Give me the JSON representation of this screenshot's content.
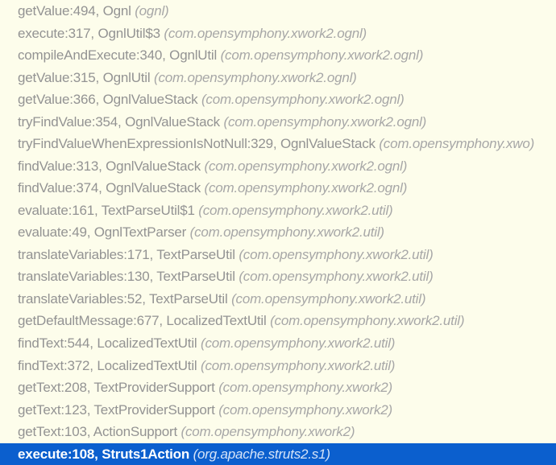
{
  "colors": {
    "background": "#fdfdeb",
    "text": "#939393",
    "pkgText": "#a7a7a7",
    "selectedBg": "#0b5fce",
    "selectedText": "#ffffff",
    "selectedPkg": "#d6e4f8"
  },
  "stackFrames": [
    {
      "method": "getValue",
      "line": 494,
      "class": "Ognl",
      "package": "ognl",
      "selected": false
    },
    {
      "method": "execute",
      "line": 317,
      "class": "OgnlUtil$3",
      "package": "com.opensymphony.xwork2.ognl",
      "selected": false
    },
    {
      "method": "compileAndExecute",
      "line": 340,
      "class": "OgnlUtil",
      "package": "com.opensymphony.xwork2.ognl",
      "selected": false
    },
    {
      "method": "getValue",
      "line": 315,
      "class": "OgnlUtil",
      "package": "com.opensymphony.xwork2.ognl",
      "selected": false
    },
    {
      "method": "getValue",
      "line": 366,
      "class": "OgnlValueStack",
      "package": "com.opensymphony.xwork2.ognl",
      "selected": false
    },
    {
      "method": "tryFindValue",
      "line": 354,
      "class": "OgnlValueStack",
      "package": "com.opensymphony.xwork2.ognl",
      "selected": false
    },
    {
      "method": "tryFindValueWhenExpressionIsNotNull",
      "line": 329,
      "class": "OgnlValueStack",
      "package": "com.opensymphony.xwo",
      "selected": false
    },
    {
      "method": "findValue",
      "line": 313,
      "class": "OgnlValueStack",
      "package": "com.opensymphony.xwork2.ognl",
      "selected": false
    },
    {
      "method": "findValue",
      "line": 374,
      "class": "OgnlValueStack",
      "package": "com.opensymphony.xwork2.ognl",
      "selected": false
    },
    {
      "method": "evaluate",
      "line": 161,
      "class": "TextParseUtil$1",
      "package": "com.opensymphony.xwork2.util",
      "selected": false
    },
    {
      "method": "evaluate",
      "line": 49,
      "class": "OgnlTextParser",
      "package": "com.opensymphony.xwork2.util",
      "selected": false
    },
    {
      "method": "translateVariables",
      "line": 171,
      "class": "TextParseUtil",
      "package": "com.opensymphony.xwork2.util",
      "selected": false
    },
    {
      "method": "translateVariables",
      "line": 130,
      "class": "TextParseUtil",
      "package": "com.opensymphony.xwork2.util",
      "selected": false
    },
    {
      "method": "translateVariables",
      "line": 52,
      "class": "TextParseUtil",
      "package": "com.opensymphony.xwork2.util",
      "selected": false
    },
    {
      "method": "getDefaultMessage",
      "line": 677,
      "class": "LocalizedTextUtil",
      "package": "com.opensymphony.xwork2.util",
      "selected": false
    },
    {
      "method": "findText",
      "line": 544,
      "class": "LocalizedTextUtil",
      "package": "com.opensymphony.xwork2.util",
      "selected": false
    },
    {
      "method": "findText",
      "line": 372,
      "class": "LocalizedTextUtil",
      "package": "com.opensymphony.xwork2.util",
      "selected": false
    },
    {
      "method": "getText",
      "line": 208,
      "class": "TextProviderSupport",
      "package": "com.opensymphony.xwork2",
      "selected": false
    },
    {
      "method": "getText",
      "line": 123,
      "class": "TextProviderSupport",
      "package": "com.opensymphony.xwork2",
      "selected": false
    },
    {
      "method": "getText",
      "line": 103,
      "class": "ActionSupport",
      "package": "com.opensymphony.xwork2",
      "selected": false
    },
    {
      "method": "execute",
      "line": 108,
      "class": "Struts1Action",
      "package": "org.apache.struts2.s1",
      "selected": true
    }
  ]
}
